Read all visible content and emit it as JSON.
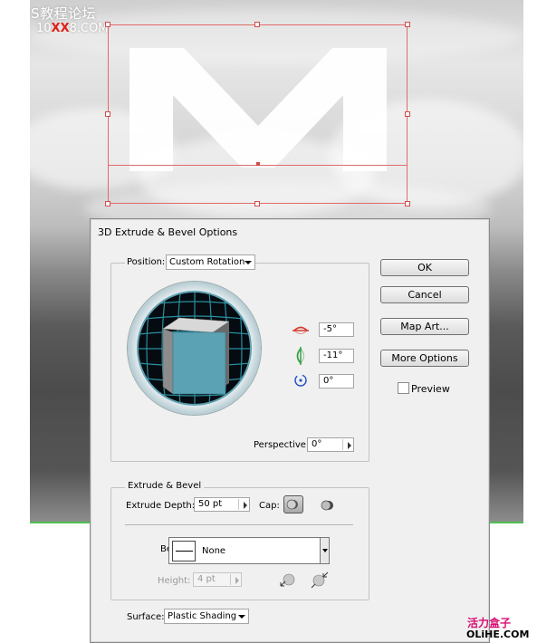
{
  "watermark": {
    "line1": "S教程论坛",
    "line2_prefix": "10",
    "line2_red": "XX",
    "line2_suffix": "8.COM"
  },
  "dialog": {
    "title": "3D Extrude & Bevel Options",
    "position": {
      "label": "Position:",
      "value": "Custom Rotation"
    },
    "rotation": {
      "x": "-5°",
      "y": "-11°",
      "z": "0°"
    },
    "perspective": {
      "label": "Perspective:",
      "value": "0°"
    },
    "extrude_bevel": {
      "title": "Extrude & Bevel",
      "depth_label": "Extrude Depth:",
      "depth_value": "50 pt",
      "cap_label": "Cap:",
      "bevel_label": "Bevel:",
      "bevel_value": "None",
      "height_label": "Height:",
      "height_value": "4 pt"
    },
    "surface": {
      "label": "Surface:",
      "value": "Plastic Shading"
    },
    "buttons": {
      "ok": "OK",
      "cancel": "Cancel",
      "map_art": "Map Art...",
      "more_options": "More Options"
    },
    "preview": {
      "label": "Preview",
      "checked": false
    }
  },
  "site": {
    "tag": "活力盒子",
    "url": "OLiHE.COM"
  },
  "colors": {
    "cube_face": "#5aa2b4",
    "selection": "#e26a6a",
    "grid": "#2a8fa0"
  }
}
